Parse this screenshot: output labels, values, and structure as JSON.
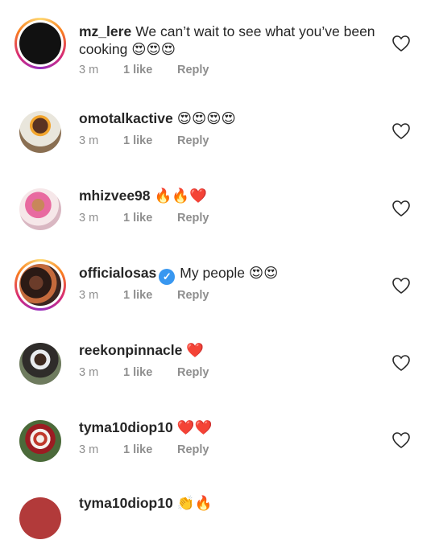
{
  "comments": [
    {
      "username": "mz_lere",
      "text": "We can’t wait to see what you’ve been cooking",
      "emoji": "😍😍😍",
      "time": "3 m",
      "likes": "1 like",
      "reply": "Reply",
      "verified": false,
      "has_story": true
    },
    {
      "username": "omotalkactive",
      "text": "",
      "emoji": "😍😍😍😍",
      "time": "3 m",
      "likes": "1 like",
      "reply": "Reply",
      "verified": false,
      "has_story": false
    },
    {
      "username": "mhizvee98",
      "text": "",
      "emoji": "🔥🔥❤️",
      "time": "3 m",
      "likes": "1 like",
      "reply": "Reply",
      "verified": false,
      "has_story": false
    },
    {
      "username": "officialosas",
      "text": "My people",
      "emoji": "😍😍",
      "time": "3 m",
      "likes": "1 like",
      "reply": "Reply",
      "verified": true,
      "has_story": true
    },
    {
      "username": "reekonpinnacle",
      "text": "",
      "emoji": "❤️",
      "time": "3 m",
      "likes": "1 like",
      "reply": "Reply",
      "verified": false,
      "has_story": false
    },
    {
      "username": "tyma10diop10",
      "text": "",
      "emoji": "❤️❤️",
      "time": "3 m",
      "likes": "1 like",
      "reply": "Reply",
      "verified": false,
      "has_story": false
    }
  ],
  "partial_next": {
    "username": "tyma10diop10",
    "emoji": "👏🔥"
  },
  "icons": {
    "like": "heart-outline-icon",
    "verified": "verified-badge-icon"
  },
  "colors": {
    "text": "#262626",
    "meta": "#8e8e8e",
    "verified": "#3897f0",
    "heart_red": "#ed4956"
  }
}
